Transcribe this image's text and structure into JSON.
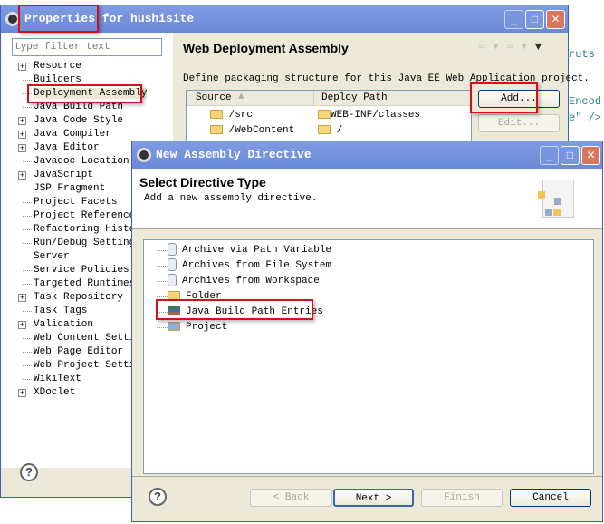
{
  "editor_bg": {
    "lines": [
      "ruts",
      "Encod",
      "e\" />"
    ]
  },
  "properties": {
    "title": "Properties for hushisite",
    "filter_placeholder": "type filter text",
    "tree": [
      {
        "label": "Resource",
        "expandable": true
      },
      {
        "label": "Builders",
        "expandable": false
      },
      {
        "label": "Deployment Assembly",
        "expandable": false,
        "selected": true
      },
      {
        "label": "Java Build Path",
        "expandable": false
      },
      {
        "label": "Java Code Style",
        "expandable": true
      },
      {
        "label": "Java Compiler",
        "expandable": true
      },
      {
        "label": "Java Editor",
        "expandable": true
      },
      {
        "label": "Javadoc Location",
        "expandable": false
      },
      {
        "label": "JavaScript",
        "expandable": true
      },
      {
        "label": "JSP Fragment",
        "expandable": false
      },
      {
        "label": "Project Facets",
        "expandable": false
      },
      {
        "label": "Project References",
        "expandable": false
      },
      {
        "label": "Refactoring Histor",
        "expandable": false
      },
      {
        "label": "Run/Debug Settings",
        "expandable": false
      },
      {
        "label": "Server",
        "expandable": false
      },
      {
        "label": "Service Policies",
        "expandable": false
      },
      {
        "label": "Targeted Runtimes",
        "expandable": false
      },
      {
        "label": "Task Repository",
        "expandable": true
      },
      {
        "label": "Task Tags",
        "expandable": false
      },
      {
        "label": "Validation",
        "expandable": true
      },
      {
        "label": "Web Content Settin",
        "expandable": false
      },
      {
        "label": "Web Page Editor",
        "expandable": false
      },
      {
        "label": "Web Project Settin",
        "expandable": false
      },
      {
        "label": "WikiText",
        "expandable": false
      },
      {
        "label": "XDoclet",
        "expandable": true
      }
    ],
    "page_title": "Web Deployment Assembly",
    "description": "Define packaging structure for this Java EE Web Application project.",
    "table": {
      "columns": [
        "Source",
        "Deploy Path"
      ],
      "rows": [
        [
          "/src",
          "WEB-INF/classes"
        ],
        [
          "/WebContent",
          "/"
        ]
      ]
    },
    "add_label": "Add...",
    "edit_label": "Edit..."
  },
  "dialog": {
    "title": "New Assembly Directive",
    "heading": "Select Directive Type",
    "subheading": "Add a new assembly directive.",
    "items": [
      {
        "label": "Archive via Path Variable",
        "icon": "jar-icon"
      },
      {
        "label": "Archives from File System",
        "icon": "jar-icon"
      },
      {
        "label": "Archives from Workspace",
        "icon": "jar-icon"
      },
      {
        "label": "Folder",
        "icon": "folder-icon"
      },
      {
        "label": "Java Build Path Entries",
        "icon": "library-icon"
      },
      {
        "label": "Project",
        "icon": "open-folder-icon"
      }
    ],
    "buttons": {
      "back": "< Back",
      "next": "Next >",
      "finish": "Finish",
      "cancel": "Cancel"
    }
  },
  "highlight_color": "#d4111b"
}
